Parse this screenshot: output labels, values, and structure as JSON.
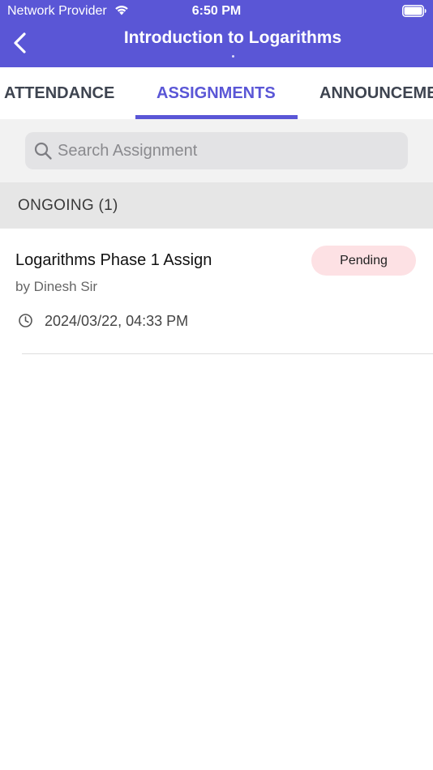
{
  "status_bar": {
    "carrier": "Network Provider",
    "time": "6:50 PM",
    "wifi_icon": "wifi-icon",
    "battery_icon": "battery-icon"
  },
  "header": {
    "title": "Introduction to Logarithms",
    "back_icon": "chevron-left-icon",
    "background": "#5a56d6"
  },
  "tabs": [
    {
      "label": "ATTENDANCE",
      "active": false
    },
    {
      "label": "ASSIGNMENTS",
      "active": true
    },
    {
      "label": "ANNOUNCEMENTS",
      "active": false
    }
  ],
  "search": {
    "placeholder": "Search Assignment",
    "value": "",
    "icon": "search-icon"
  },
  "sections": [
    {
      "title": "ONGOING (1)",
      "items": [
        {
          "title": "Logarithms Phase 1 Assign",
          "author": "by Dinesh Sir",
          "status": "Pending",
          "status_color": "#fde1e4",
          "datetime": "2024/03/22, 04:33 PM",
          "clock_icon": "clock-icon"
        }
      ]
    }
  ],
  "colors": {
    "accent": "#5a56d6",
    "tab_inactive": "#3e4450",
    "section_bg": "#e6e6e6",
    "search_bg": "#e3e3e5"
  }
}
